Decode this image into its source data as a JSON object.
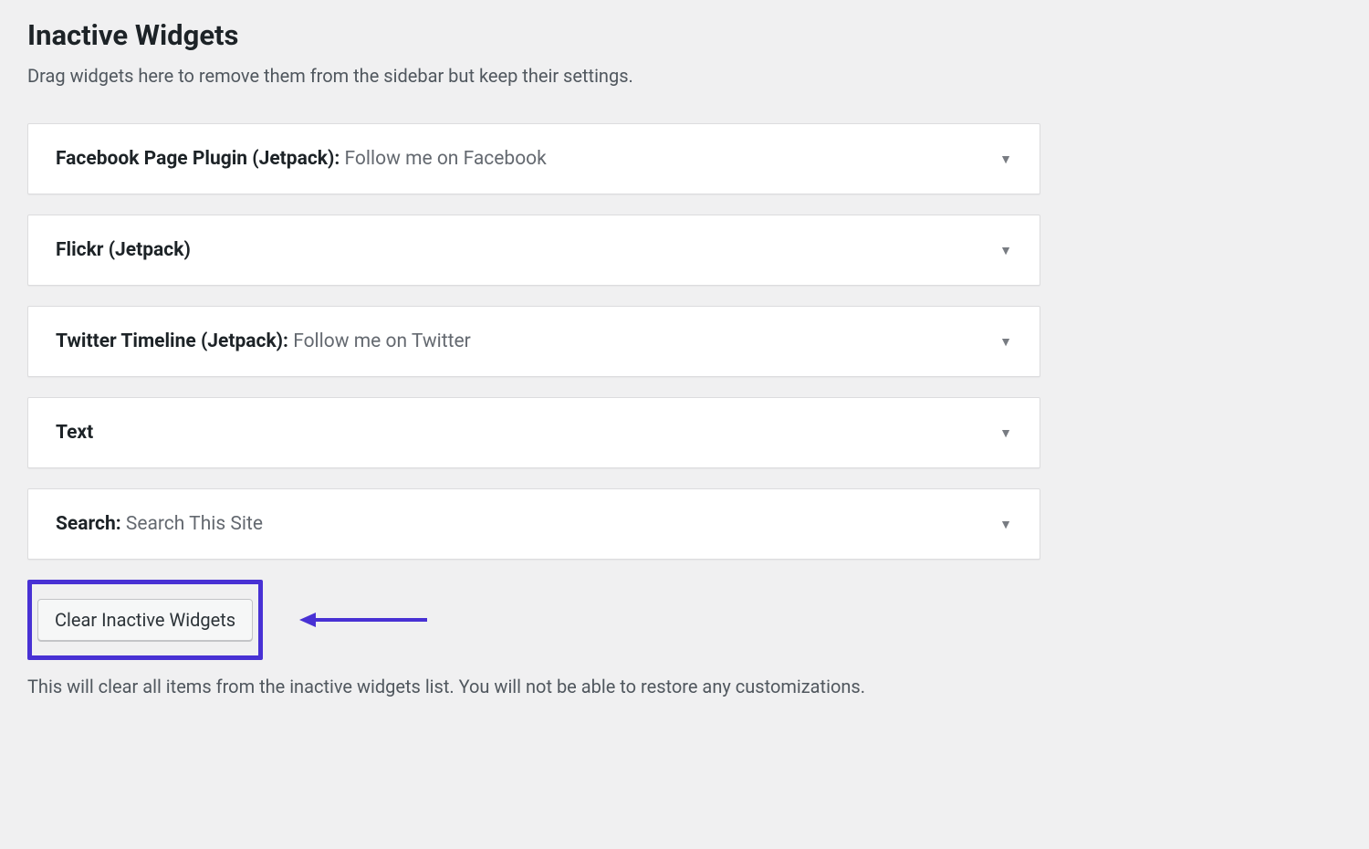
{
  "section": {
    "title": "Inactive Widgets",
    "description": "Drag widgets here to remove them from the sidebar but keep their settings."
  },
  "widgets": [
    {
      "name": "Facebook Page Plugin (Jetpack)",
      "subtitle": "Follow me on Facebook",
      "has_subtitle": true
    },
    {
      "name": "Flickr (Jetpack)",
      "subtitle": "",
      "has_subtitle": false
    },
    {
      "name": "Twitter Timeline (Jetpack)",
      "subtitle": "Follow me on Twitter",
      "has_subtitle": true
    },
    {
      "name": "Text",
      "subtitle": "",
      "has_subtitle": false
    },
    {
      "name": "Search",
      "subtitle": "Search This Site",
      "has_subtitle": true
    }
  ],
  "clear": {
    "button_label": "Clear Inactive Widgets",
    "description": "This will clear all items from the inactive widgets list. You will not be able to restore any customizations."
  }
}
